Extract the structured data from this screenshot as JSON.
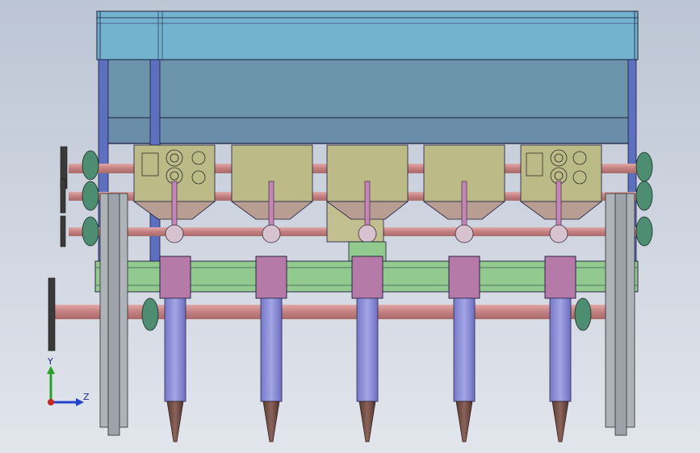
{
  "axis_triad": {
    "y_label": "Y",
    "z_label": "Z"
  },
  "colors": {
    "background_top": "#bfc8d6",
    "background_bottom": "#dfe3ea",
    "hopper_upper": "#6fb0cc",
    "hopper_lower": "#6a93a8",
    "frame_blue": "#5b6fbf",
    "seed_box": "#b9b884",
    "funnel_tan": "#b39a8f",
    "pink_part": "#b57aa8",
    "green_beam": "#8fc58b",
    "red_shaft": "#c98888",
    "tube_purple": "#8d8fd8",
    "tip_brown": "#6e4b43",
    "bearing_green": "#4d8d72",
    "grey_plate": "#a9aeb5"
  },
  "units": {
    "count": 5
  }
}
